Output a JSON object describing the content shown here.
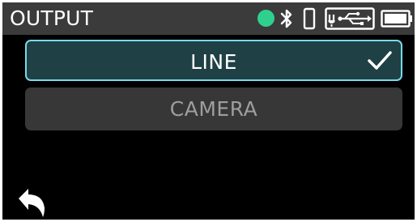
{
  "header": {
    "title": "OUTPUT",
    "status_dot_color": "#2fd08e",
    "icons": [
      "bluetooth-icon",
      "phone-icon",
      "usb-power-icon",
      "battery-icon"
    ]
  },
  "options": [
    {
      "label": "LINE",
      "selected": true
    },
    {
      "label": "CAMERA",
      "selected": false
    }
  ],
  "colors": {
    "accent": "#7ad8ea",
    "selected_background": "#1f4045",
    "unselected_background": "#373737",
    "header_background": "#3b3b3b"
  },
  "footer": {
    "back_icon": "back-arrow-icon"
  }
}
